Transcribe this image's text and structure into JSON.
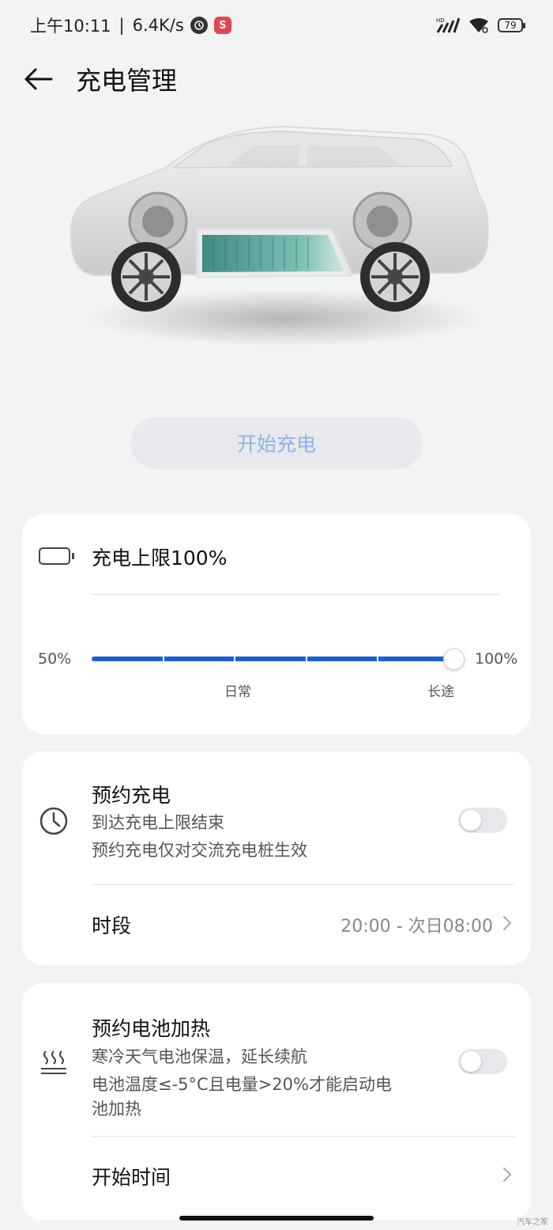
{
  "status_bar": {
    "time": "上午10:11",
    "separator": "|",
    "net_speed": "6.4K/s",
    "battery_level": "79",
    "icons": [
      "clock-dot-icon",
      "app-badge-icon",
      "hd-signal-icon",
      "wifi-icon",
      "battery-icon"
    ]
  },
  "header": {
    "title": "充电管理",
    "back_icon": "arrow-left-icon"
  },
  "car_image": {
    "description_icon": "car-battery-illustration"
  },
  "start_charge": {
    "label": "开始充电"
  },
  "charge_limit": {
    "label": "充电上限100%",
    "min_label": "50%",
    "max_label": "100%",
    "value_fraction": 1.0,
    "mark_daily": "日常",
    "mark_long": "长途",
    "accent": "#1a5fd6"
  },
  "scheduled_charge": {
    "title": "预约充电",
    "sub1": "到达充电上限结束",
    "sub2": "预约充电仅对交流充电桩生效",
    "enabled": false,
    "period_label": "时段",
    "period_value": "20:00 - 次日08:00"
  },
  "battery_heating": {
    "title": "预约电池加热",
    "sub1": "寒冷天气电池保温，延长续航",
    "sub2": "电池温度≤-5°C且电量>20%才能启动电",
    "sub3": "池加热",
    "enabled": false,
    "start_time_label": "开始时间"
  },
  "watermark": "汽车之家"
}
